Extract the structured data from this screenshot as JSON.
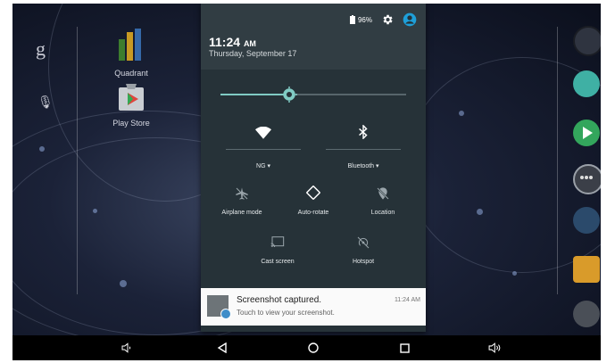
{
  "status": {
    "battery": "96%",
    "time": "11:24",
    "ampm": "AM",
    "date": "Thursday, September 17"
  },
  "brightness": {
    "level": 0.37
  },
  "tiles": [
    {
      "id": "wifi",
      "label": "NG ▾",
      "icon": "wifi-icon"
    },
    {
      "id": "bluetooth",
      "label": "Bluetooth ▾",
      "icon": "bluetooth-icon"
    },
    {
      "id": "airplane",
      "label": "Airplane mode",
      "icon": "airplane-icon"
    },
    {
      "id": "autorotate",
      "label": "Auto-rotate",
      "icon": "auto-rotate-icon"
    },
    {
      "id": "location",
      "label": "Location",
      "icon": "location-off-icon"
    },
    {
      "id": "cast",
      "label": "Cast screen",
      "icon": "cast-icon"
    },
    {
      "id": "hotspot",
      "label": "Hotspot",
      "icon": "hotspot-icon"
    }
  ],
  "notification": {
    "title": "Screenshot captured.",
    "text": "Touch to view your screenshot.",
    "time": "11:24 AM"
  },
  "desktop": {
    "icons": [
      {
        "label": "Quadrant",
        "icon": "quadrant-icon"
      },
      {
        "label": "Play Store",
        "icon": "play-store-icon"
      }
    ],
    "google_label": "g"
  },
  "colors": {
    "shade_bg": "#263238",
    "accent": "#80cbc4"
  }
}
